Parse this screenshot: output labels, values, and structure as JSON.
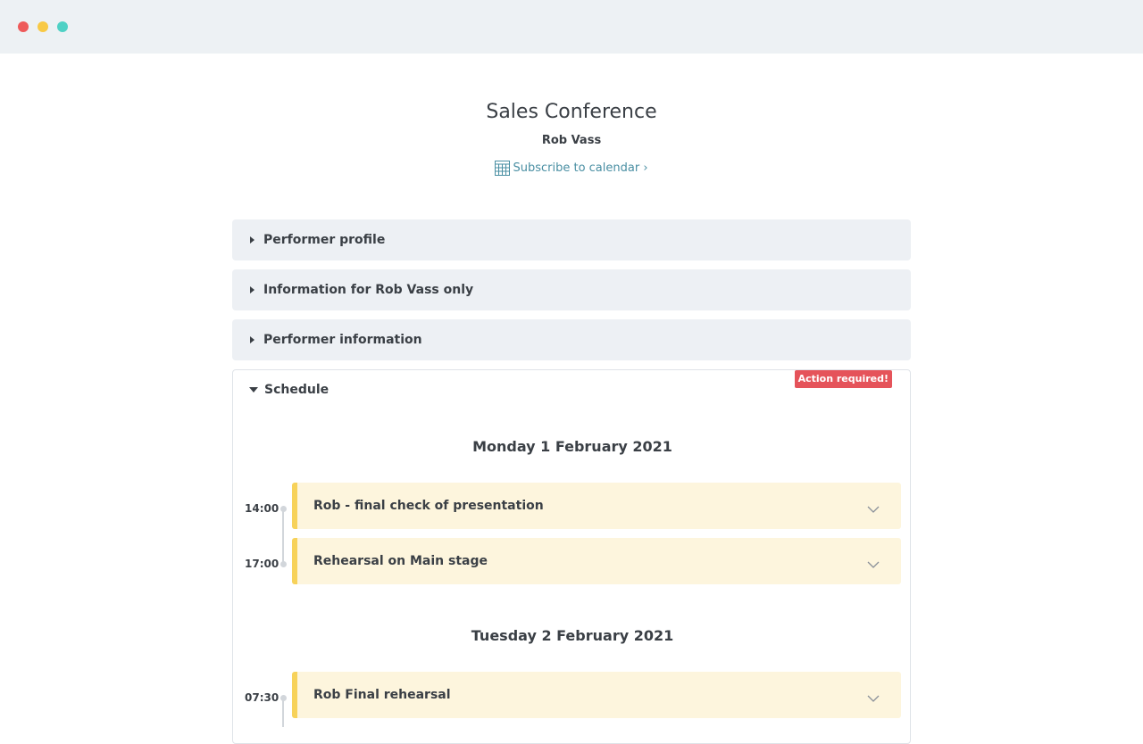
{
  "window": {
    "controls": [
      "close",
      "minimize",
      "maximize"
    ]
  },
  "header": {
    "title": "Sales Conference",
    "performer": "Rob Vass",
    "subscribe_label": "Subscribe to calendar ›",
    "subscribe_icon": "calendar-icon"
  },
  "sections": [
    {
      "label": "Performer profile",
      "expanded": false
    },
    {
      "label": "Information for Rob Vass only",
      "expanded": false
    },
    {
      "label": "Performer information",
      "expanded": false
    }
  ],
  "schedule": {
    "label": "Schedule",
    "expanded": true,
    "badge": "Action required!",
    "days": [
      {
        "date": "Monday 1 February 2021",
        "events": [
          {
            "time": "14:00",
            "title": "Rob - final check of presentation"
          },
          {
            "time": "17:00",
            "title": "Rehearsal on Main stage"
          }
        ]
      },
      {
        "date": "Tuesday 2 February 2021",
        "events": [
          {
            "time": "07:30",
            "title": "Rob Final rehearsal"
          }
        ]
      }
    ]
  },
  "colors": {
    "accent_link": "#4a8fa3",
    "badge_bg": "#e5535a",
    "event_bg": "#fdf5dd",
    "event_border": "#f7d25a",
    "section_bg": "#edf0f4"
  }
}
